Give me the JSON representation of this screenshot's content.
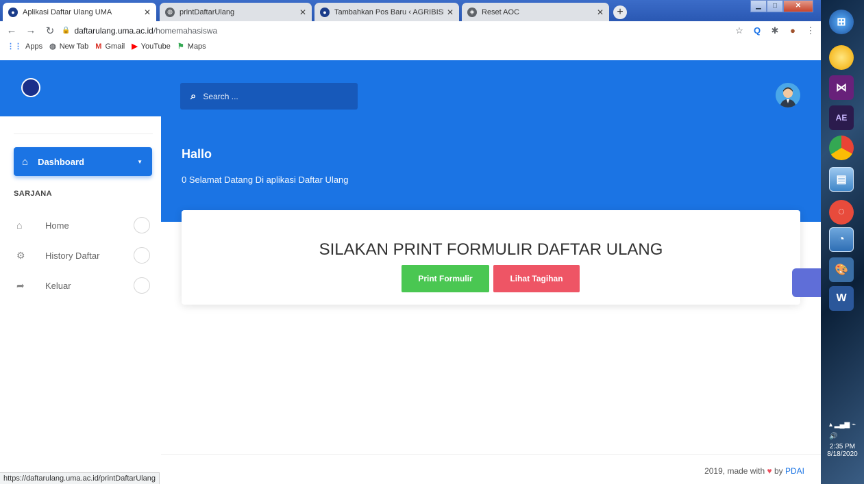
{
  "browser": {
    "tabs": [
      {
        "title": "Aplikasi Daftar Ulang UMA",
        "favicon_color": "#1a3c8a",
        "active": true
      },
      {
        "title": "printDaftarUlang",
        "favicon_color": "#5f6368",
        "active": false
      },
      {
        "title": "Tambahkan Pos Baru ‹ AGRIBISNIS",
        "favicon_color": "#1a3c8a",
        "active": false
      },
      {
        "title": "Reset AOC",
        "favicon_color": "#5f6368",
        "active": false
      }
    ],
    "new_tab_label": "+",
    "address_host": "daftarulang.uma.ac.id",
    "address_path": "/homemahasiswa",
    "bookmarks": [
      {
        "label": "Apps",
        "icon": "apps-grid-icon"
      },
      {
        "label": "New Tab",
        "icon": "globe-icon"
      },
      {
        "label": "Gmail",
        "icon": "gmail-icon"
      },
      {
        "label": "YouTube",
        "icon": "youtube-icon"
      },
      {
        "label": "Maps",
        "icon": "maps-icon"
      }
    ],
    "status_url": "https://daftarulang.uma.ac.id/printDaftarUlang"
  },
  "app": {
    "search_placeholder": "Search ...",
    "sidebar": {
      "dashboard_label": "Dashboard",
      "section_label": "SARJANA",
      "items": [
        {
          "label": "Home",
          "icon": "home-icon"
        },
        {
          "label": "History Daftar",
          "icon": "cogs-icon"
        },
        {
          "label": "Keluar",
          "icon": "sign-out-icon"
        }
      ]
    },
    "hero": {
      "title": "Hallo",
      "subtitle": "0 Selamat Datang Di aplikasi Daftar Ulang"
    },
    "card": {
      "title": "SILAKAN PRINT FORMULIR DAFTAR ULANG",
      "print_button": "Print Formulir",
      "tagihan_button": "Lihat Tagihan"
    },
    "footer": {
      "prefix": "2019, made with",
      "by": "by",
      "author": "PDAI"
    }
  },
  "taskbar": {
    "clock_time": "2:35 PM",
    "clock_date": "8/18/2020",
    "ae_label": "AE",
    "word_label": "W"
  },
  "colors": {
    "primary": "#1b74e4",
    "success": "#4ac752",
    "danger": "#ee5565"
  }
}
